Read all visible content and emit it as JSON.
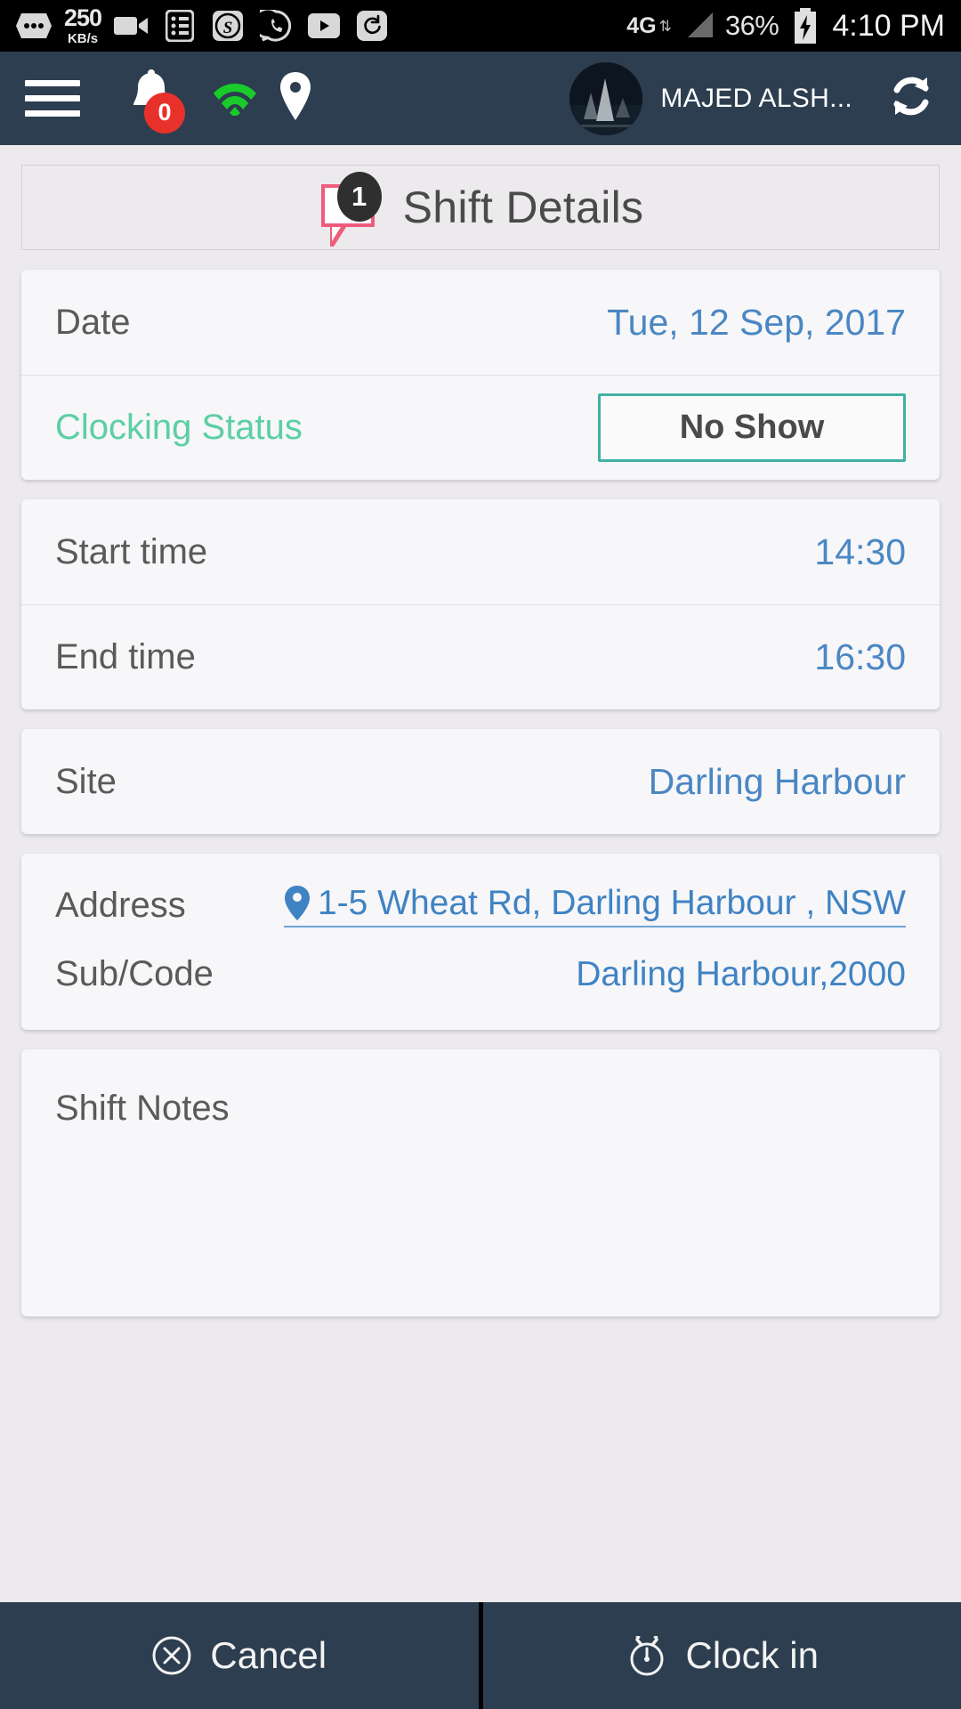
{
  "status_bar": {
    "icons": [
      "more-dots-icon",
      "video-camera-icon",
      "list-icon",
      "shazam-icon",
      "whatsapp-icon",
      "youtube-icon",
      "sync-icon"
    ],
    "data_speed_value": "250",
    "data_speed_unit": "KB/s",
    "network_type": "4G",
    "battery_percent": "36%",
    "time": "4:10 PM"
  },
  "app_bar": {
    "menu_icon": "hamburger-menu-icon",
    "notification_icon": "bell-icon",
    "notification_count": "0",
    "wifi_icon": "wifi-icon",
    "location_icon": "location-pin-icon",
    "avatar": "user-avatar",
    "user_name": "MAJED ALSH...",
    "refresh_icon": "refresh-icon",
    "background_color": "#2d3e50"
  },
  "page": {
    "title": "Shift Details",
    "title_icon": "chat-bubble-icon",
    "title_badge_count": "1"
  },
  "shift": {
    "date_label": "Date",
    "date_value": "Tue, 12 Sep, 2017",
    "clocking_status_label": "Clocking Status",
    "clocking_status_value": "No Show",
    "start_time_label": "Start time",
    "start_time_value": "14:30",
    "end_time_label": "End time",
    "end_time_value": "16:30",
    "site_label": "Site",
    "site_value": "Darling Harbour",
    "address_label": "Address",
    "address_value": "1-5 Wheat Rd, Darling Harbour , NSW",
    "address_pin_icon": "map-pin-icon",
    "subcode_label": "Sub/Code",
    "subcode_value": "Darling Harbour,2000",
    "notes_label": "Shift Notes",
    "notes_value": ""
  },
  "actions": {
    "cancel_label": "Cancel",
    "cancel_icon": "circle-x-icon",
    "clockin_label": "Clock in",
    "clockin_icon": "stopwatch-icon"
  },
  "colors": {
    "accent_blue": "#4a87c4",
    "status_green": "#5ccfa3",
    "status_box_border": "#42b0a2",
    "badge_red": "#e8312b",
    "bubble_pink": "#ef5b7c",
    "navy": "#2d3e50"
  }
}
